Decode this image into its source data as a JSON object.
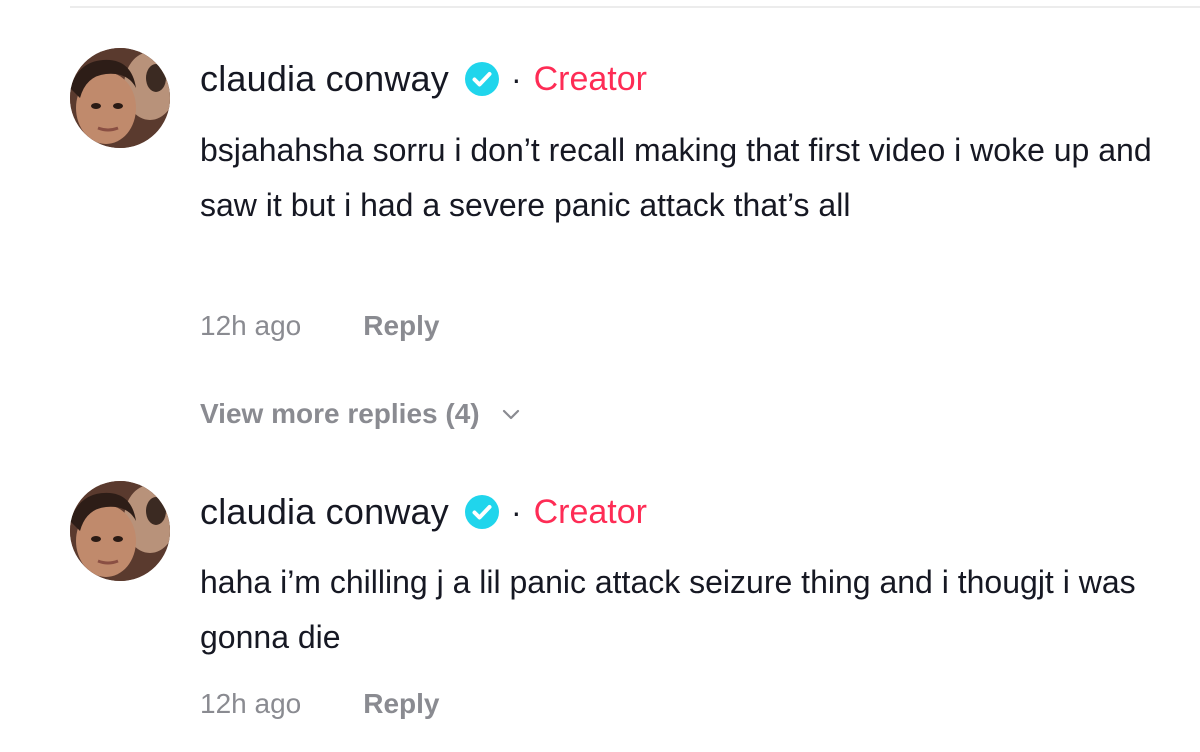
{
  "comments": [
    {
      "username": "claudia conway",
      "separator": "·",
      "creator_label": "Creator",
      "text": "bsjahahsha sorru i don’t recall making that first video i woke up and saw it but i had a severe panic attack that’s all",
      "timestamp": "12h ago",
      "reply_label": "Reply",
      "avatar_icon": "avatar-photo",
      "verified_icon": "verified-badge-icon"
    },
    {
      "username": "claudia conway",
      "separator": "·",
      "creator_label": "Creator",
      "text": "haha i’m chilling j a lil panic attack seizure thing and i thougjt i was gonna die",
      "timestamp": "12h ago",
      "reply_label": "Reply",
      "avatar_icon": "avatar-photo",
      "verified_icon": "verified-badge-icon"
    }
  ],
  "view_more": {
    "label": "View more replies (4)",
    "icon": "chevron-down-icon"
  },
  "colors": {
    "creator": "#fe2c55",
    "verified": "#20d5ec",
    "meta_text": "#8a8b91",
    "text": "#161823"
  }
}
